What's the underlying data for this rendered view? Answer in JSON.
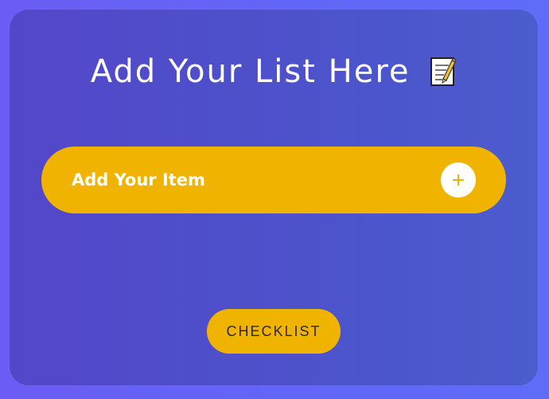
{
  "title": {
    "text": "Add Your List Here"
  },
  "icons": {
    "memo": "memo-icon",
    "add": "plus-icon"
  },
  "input": {
    "placeholder": "Add Your Item"
  },
  "button": {
    "checklist_label": "CHECKLIST"
  },
  "colors": {
    "outer_background": "#6266f6",
    "card_background": "#4d52cb",
    "accent": "#f0b400",
    "text_light": "#ffffff",
    "text_dark": "#2a2740"
  }
}
